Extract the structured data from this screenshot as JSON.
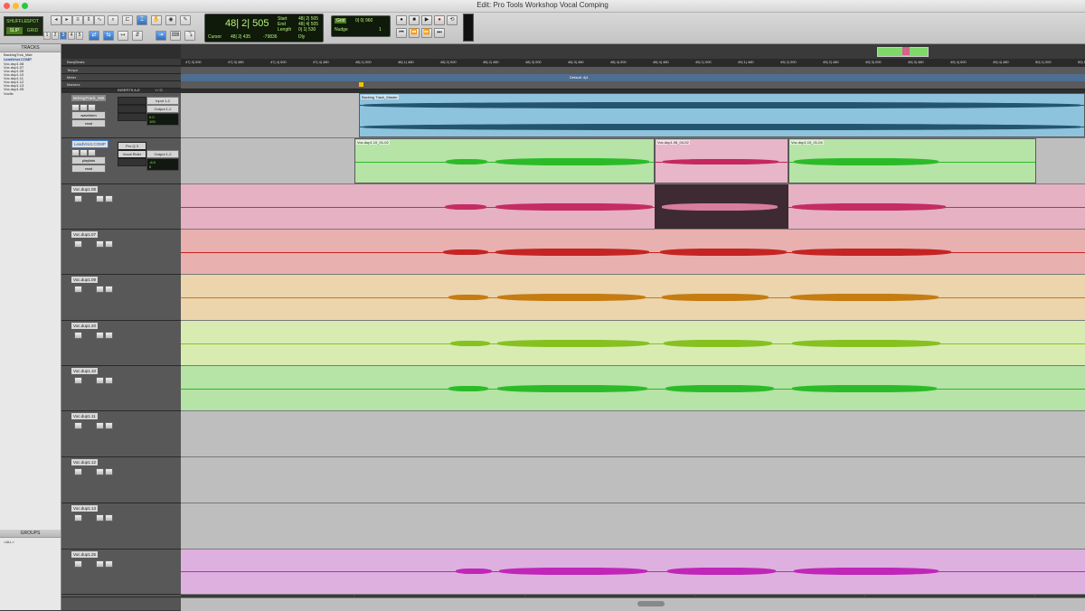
{
  "window": {
    "title": "Edit: Pro Tools Workshop Vocal Comping"
  },
  "toolbar": {
    "modes": [
      "SHUFFLE",
      "SPOT",
      "SLIP",
      "GRID"
    ],
    "active_mode": "SLIP",
    "number_buttons": [
      "1",
      "2",
      "3",
      "4",
      "5"
    ],
    "counter": {
      "main": "48| 2| 505",
      "start_label": "Start",
      "end_label": "End",
      "length_label": "Length",
      "start_value": "48| 2| 505",
      "end_value": "48| 4| 505",
      "length_value": "0| 1| 530",
      "cursor_label": "Cursor",
      "cursor_value": "48| 2| 435",
      "sample_value": "-79836",
      "dly_label": "Dly"
    },
    "grid": {
      "grid_label": "Grid",
      "grid_value": "0| 0| 960",
      "nudge_label": "Nudge",
      "nudge_value": "1"
    }
  },
  "tracks_panel": {
    "header": "TRACKS",
    "items": [
      "BackingTrck_Mstr",
      "LeadVrsct.COMP",
      "Voc.dup1.08",
      "Voc.dup1.07",
      "Voc.dup1.09",
      "Voc.dup1.10",
      "Voc.dup1.11",
      "Voc.dup1.12",
      "Voc.dup1.13",
      "Voc.dup1.05",
      "Vocfix"
    ]
  },
  "groups_panel": {
    "header": "GROUPS",
    "items": [
      "<ALL>"
    ]
  },
  "ruler": {
    "bars_beats_label": "Bars|Beats",
    "tempo_label": "Tempo",
    "meter_label": "Meter",
    "markers_label": "Markers",
    "tempo_value": "Default: 4|4",
    "ticks": [
      "47| 3| 000",
      "47| 3| 480",
      "47| 4| 000",
      "47| 4| 480",
      "48| 1| 000",
      "48| 1| 480",
      "48| 2| 000",
      "48| 2| 480",
      "48| 3| 000",
      "48| 3| 480",
      "48| 4| 000",
      "48| 4| 480",
      "49| 1| 000",
      "49| 1| 480",
      "49| 2| 000",
      "49| 2| 480",
      "49| 3| 000",
      "49| 3| 480",
      "49| 4| 000",
      "49| 4| 480",
      "50| 1| 000",
      "50| 1| 480"
    ]
  },
  "tracks": [
    {
      "name": "BckingTrack_Mst",
      "inserts_label": "INSERTS A-E",
      "io_label": "I / O",
      "input": "Input 1-2",
      "output": "Output 1-2",
      "view": "waveform",
      "mode": "read",
      "vol": "0.0",
      "pan": "100",
      "clips": [
        {
          "name": "Backing Track_Master",
          "color": "#7fb3d8",
          "wave": "#1f4f6a"
        }
      ]
    },
    {
      "name": "LeadVrsct.COMP",
      "send": "Pro-Q 3",
      "output": "Output 1-2",
      "io_insert": "Vocal Rider",
      "view": "playlists",
      "mode": "read",
      "vol": "-6.0",
      "pan": "0",
      "clips": [
        {
          "name": "Voc.dup1.10_01-02",
          "color": "#b6e3a6",
          "wave": "#2bbb28"
        },
        {
          "name": "Voc.dup1.08_04-02",
          "color": "#e7b6c8",
          "wave": "#c4285c"
        },
        {
          "name": "Voc.dup1.10_01-04",
          "color": "#b6e3a6",
          "wave": "#2bbb28"
        }
      ]
    },
    {
      "name": "Voc.dup1.08",
      "color": "#e5b1c3",
      "wave": "#c42c63"
    },
    {
      "name": "Voc.dup1.07",
      "color": "#e8b0ae",
      "wave": "#c42424"
    },
    {
      "name": "Voc.dup1.09",
      "color": "#ecd4ad",
      "wave": "#c57c10"
    },
    {
      "name": "Voc.dup1.20",
      "color": "#d8ecb2",
      "wave": "#86c11f"
    },
    {
      "name": "Voc.dup1.10",
      "color": "#b6e3a6",
      "wave": "#2bbb28"
    },
    {
      "name": "Voc.dup1.11"
    },
    {
      "name": "Voc.dup1.12"
    },
    {
      "name": "Voc.dup1.13"
    },
    {
      "name": "Voc.dup1.25",
      "color": "#deb0e0",
      "wave": "#c026b8"
    },
    {
      "name": "Vocfix"
    }
  ]
}
